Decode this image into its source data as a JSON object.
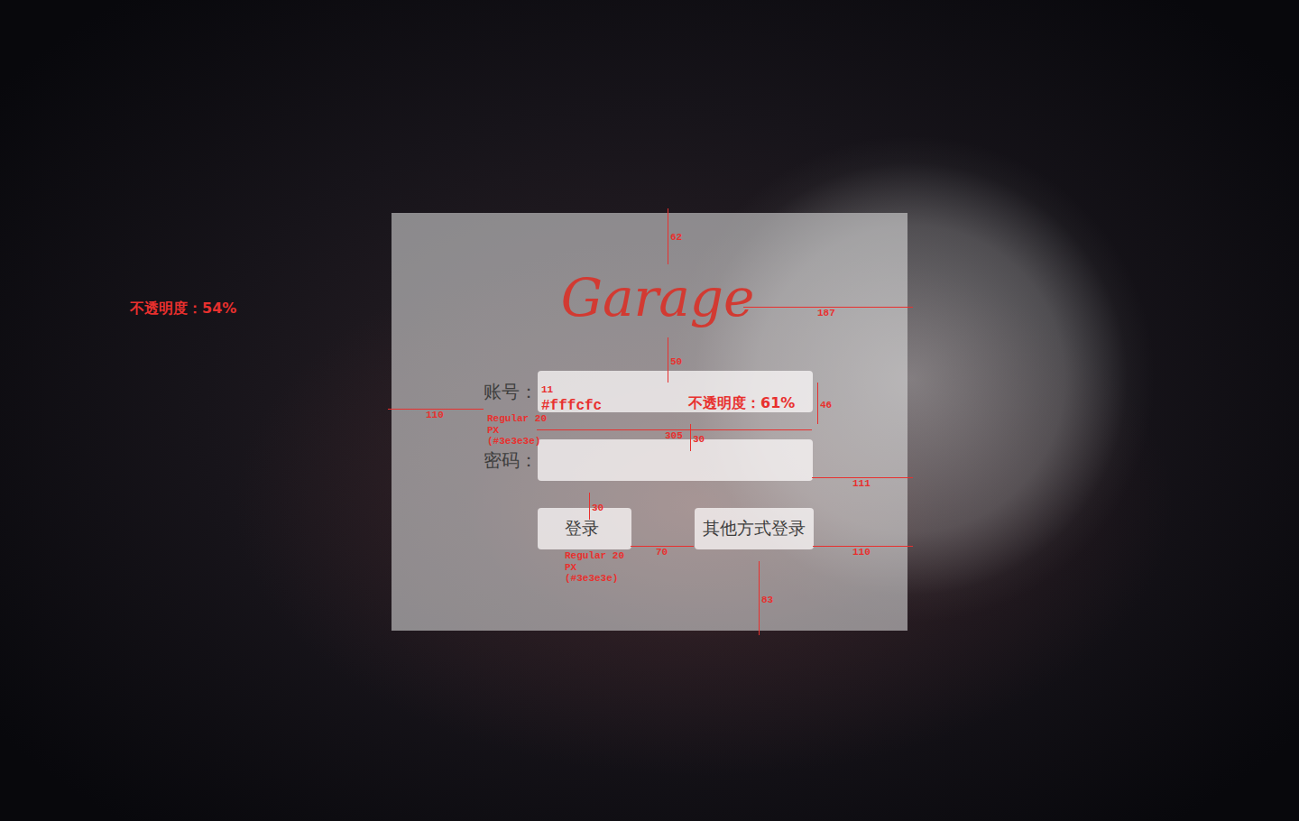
{
  "logo": "Garage",
  "form": {
    "fields": [
      {
        "label": "账号："
      },
      {
        "label": "密码："
      }
    ],
    "buttons": [
      "登录",
      "其他方式登录"
    ]
  },
  "annotations": [
    {
      "text": "不透明度：54%"
    },
    {
      "text": "62"
    },
    {
      "text": "187"
    },
    {
      "text": "50"
    },
    {
      "text": "110"
    },
    {
      "text": "#fffcfc"
    },
    {
      "text": "不透明度：61%"
    },
    {
      "text": "46"
    },
    {
      "text": "11"
    },
    {
      "text": "Regular 20 PX (#3e3e3e)"
    },
    {
      "text": "305"
    },
    {
      "text": "30"
    },
    {
      "text": "111"
    },
    {
      "text": "30"
    },
    {
      "text": "Regular 20 PX (#3e3e3e)"
    },
    {
      "text": "70"
    },
    {
      "text": "110"
    },
    {
      "text": "83"
    }
  ]
}
